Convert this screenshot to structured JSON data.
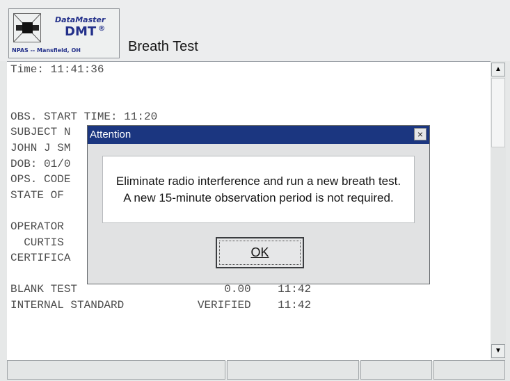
{
  "header": {
    "logo": {
      "name": "DataMaster",
      "model": "DMT",
      "registered_mark": "®",
      "agency": "NPAS -- Mansfield, OH"
    },
    "title": "Breath Test"
  },
  "output": {
    "text": "Time: 11:41:36\n\n\nOBS. START TIME: 11:20\nSUBJECT N\nJOHN J SM\nDOB: 01/0\nOPS. CODE\nSTATE OF \n\nOPERATOR \n  CURTIS \nCERTIFICA\n\nBLANK TEST                      0.00    11:42\nINTERNAL STANDARD           VERIFIED    11:42"
  },
  "scrollbar": {
    "up_arrow": "▲",
    "down_arrow": "▼"
  },
  "dialog": {
    "title": "Attention",
    "close_glyph": "×",
    "message": "Eliminate radio interference and run a new breath test. A new 15-minute observation period is not required.",
    "ok_label": "OK"
  },
  "colors": {
    "dialog_titlebar": "#1b3680",
    "logo_text": "#23308a",
    "output_text": "#4c4c4c"
  }
}
